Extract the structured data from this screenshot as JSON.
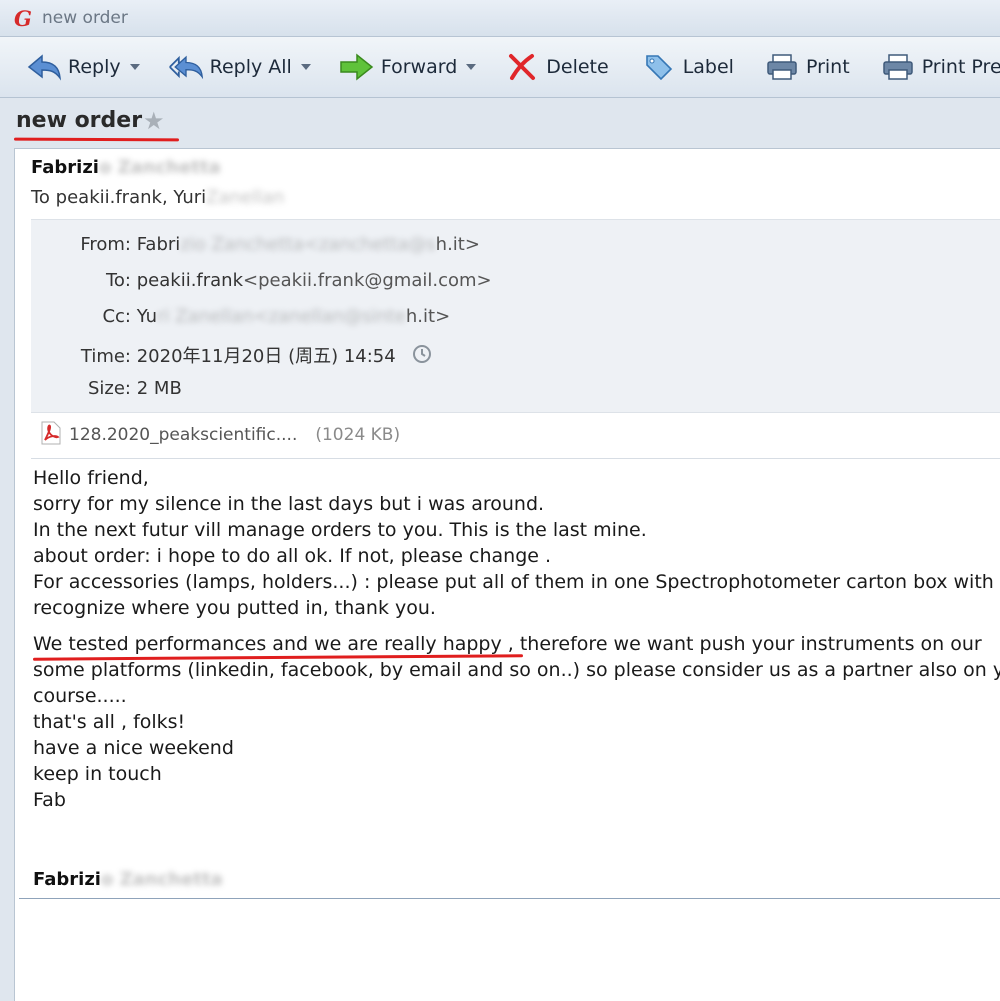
{
  "window": {
    "title": "new order"
  },
  "toolbar": {
    "reply": "Reply",
    "reply_all": "Reply All",
    "forward": "Forward",
    "delete": "Delete",
    "label": "Label",
    "print": "Print",
    "print_preview": "Print Preview"
  },
  "message": {
    "subject": "new order",
    "sender_name": "Fabrizi",
    "to_summary": "To peakii.frank, Yuri",
    "from_label": "From:",
    "from_value": "Fabri",
    "from_tail": "h.it>",
    "to_label": "To:",
    "to_name": "peakii.frank",
    "to_addr": "<peakii.frank@gmail.com>",
    "cc_label": "Cc:",
    "cc_value": "Yu",
    "cc_tail": "h.it>",
    "time_label": "Time:",
    "time_value": "2020年11月20日 (周五) 14:54",
    "size_label": "Size:",
    "size_value": "2 MB",
    "attachment_name": "128.2020_peakscientific....",
    "attachment_size": "(1024 KB)",
    "body_lines": [
      "Hello  friend,",
      "sorry for my silence in the last days but i was around.",
      "In the next futur           vill manage orders to you. This is the last mine.",
      "about order: i hope to do all ok. If not, please change .",
      "For accessories (lamps, holders...) : please put all of them in one Spectrophotometer carton  box with",
      "recognize where you putted in, thank you.",
      "We tested performances  and we are really happy , therefore we want push your instruments on our",
      "some platforms (linkedin, facebook, by email and so on..) so please consider us as a partner also on y",
      "course.....",
      "that's all , folks!",
      "have a nice weekend",
      "keep in touch",
      "Fab"
    ],
    "signature": "Fabrizi"
  }
}
